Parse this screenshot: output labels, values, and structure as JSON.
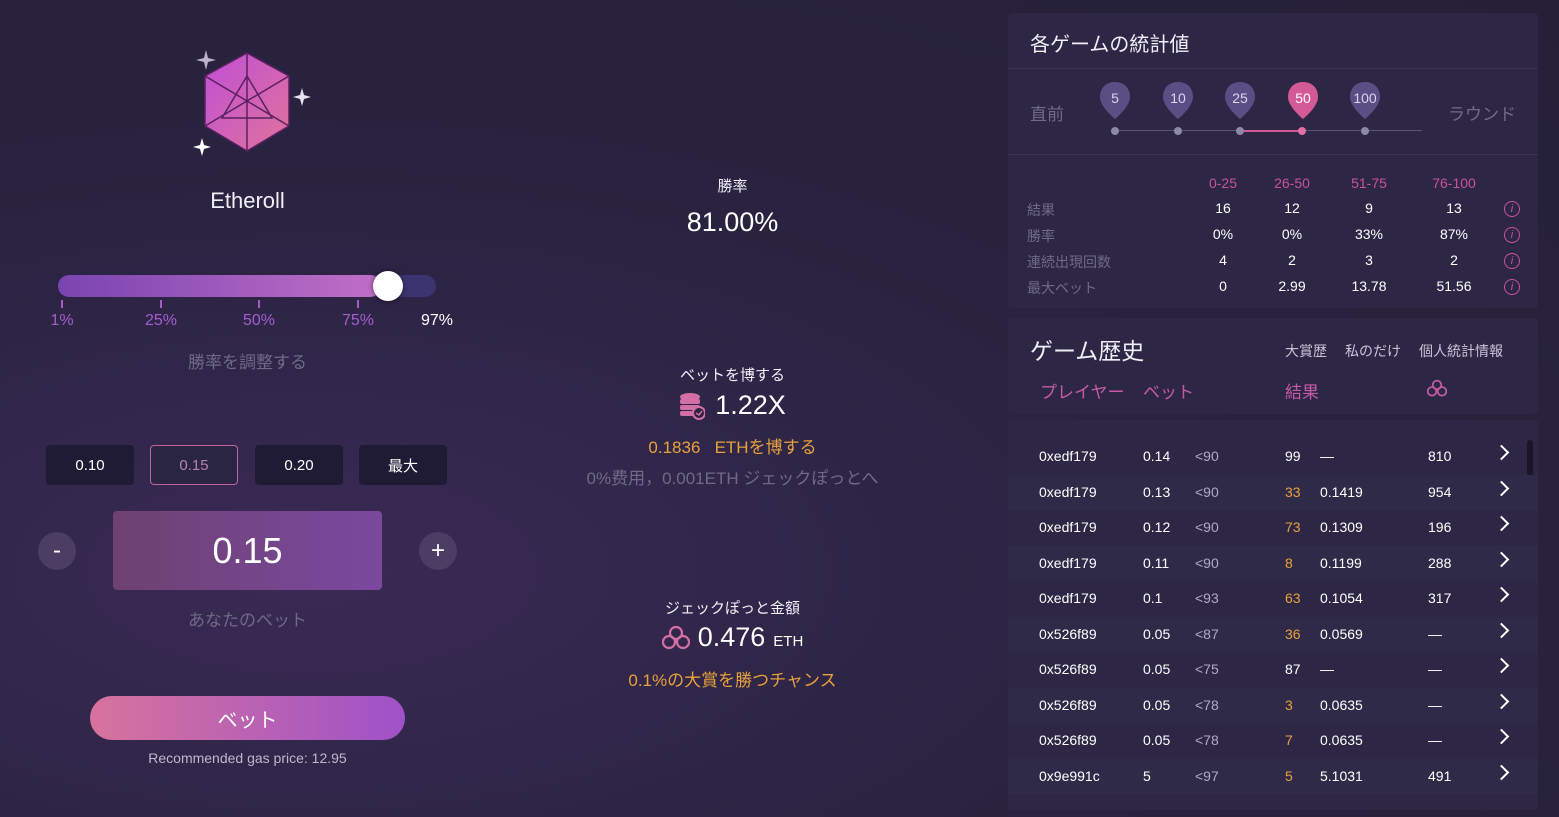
{
  "game": {
    "name": "Etheroll"
  },
  "slider": {
    "value_percent": 97,
    "ticks": [
      "1%",
      "25%",
      "50%",
      "75%"
    ],
    "current_label": "97%",
    "hint": "勝率を調整する"
  },
  "bet": {
    "chips": [
      "0.10",
      "0.15",
      "0.20",
      "最大"
    ],
    "active_chip": "0.15",
    "minus": "-",
    "plus": "+",
    "value": "0.15",
    "hint": "あなたのベット",
    "button": "ベット",
    "gas": "Recommended gas price: 12.95"
  },
  "middle": {
    "winrate_label": "勝率",
    "winrate_value": "81.00%",
    "payout_label": "ベットを博する",
    "payout_value": "1.22X",
    "payout_amount": "0.1836",
    "payout_amount_suffix": "ETHを博する",
    "fee_text": "0%费用，0.001ETH ジェックぽっとへ",
    "jackpot_label": "ジェックぽっと金額",
    "jackpot_value": "0.476",
    "jackpot_unit": "ETH",
    "jackpot_chance": "0.1%の大賞を勝つチャンス"
  },
  "stats": {
    "title": "各ゲームの統計値",
    "left_label": "直前",
    "right_label": "ラウンド",
    "rounds": [
      "5",
      "10",
      "25",
      "50",
      "100"
    ],
    "selected_round": "50",
    "columns": [
      "0-25",
      "26-50",
      "51-75",
      "76-100"
    ],
    "rows": [
      {
        "label": "結果",
        "values": [
          "16",
          "12",
          "9",
          "13"
        ]
      },
      {
        "label": "勝率",
        "values": [
          "0%",
          "0%",
          "33%",
          "87%"
        ]
      },
      {
        "label": "連続出現回数",
        "values": [
          "4",
          "2",
          "3",
          "2"
        ]
      },
      {
        "label": "最大ベット",
        "values": [
          "0",
          "2.99",
          "13.78",
          "51.56"
        ]
      }
    ],
    "info_glyph": "i"
  },
  "history": {
    "title": "ゲーム歴史",
    "tabs": [
      "大賞歴",
      "私のだけ",
      "個人統計情報"
    ],
    "headers": {
      "player": "プレイヤー",
      "bet": "ベット",
      "result": "結果"
    },
    "rows": [
      {
        "player": "0xedf179",
        "bet": "0.14",
        "target": "<90",
        "roll": "99",
        "win": false,
        "payout": "—",
        "extra": "810"
      },
      {
        "player": "0xedf179",
        "bet": "0.13",
        "target": "<90",
        "roll": "33",
        "win": true,
        "payout": "0.1419",
        "extra": "954"
      },
      {
        "player": "0xedf179",
        "bet": "0.12",
        "target": "<90",
        "roll": "73",
        "win": true,
        "payout": "0.1309",
        "extra": "196"
      },
      {
        "player": "0xedf179",
        "bet": "0.11",
        "target": "<90",
        "roll": "8",
        "win": true,
        "payout": "0.1199",
        "extra": "288"
      },
      {
        "player": "0xedf179",
        "bet": "0.1",
        "target": "<93",
        "roll": "63",
        "win": true,
        "payout": "0.1054",
        "extra": "317"
      },
      {
        "player": "0x526f89",
        "bet": "0.05",
        "target": "<87",
        "roll": "36",
        "win": true,
        "payout": "0.0569",
        "extra": "—"
      },
      {
        "player": "0x526f89",
        "bet": "0.05",
        "target": "<75",
        "roll": "87",
        "win": false,
        "payout": "—",
        "extra": "—"
      },
      {
        "player": "0x526f89",
        "bet": "0.05",
        "target": "<78",
        "roll": "3",
        "win": true,
        "payout": "0.0635",
        "extra": "—"
      },
      {
        "player": "0x526f89",
        "bet": "0.05",
        "target": "<78",
        "roll": "7",
        "win": true,
        "payout": "0.0635",
        "extra": "—"
      },
      {
        "player": "0x9e991c",
        "bet": "5",
        "target": "<97",
        "roll": "5",
        "win": true,
        "payout": "5.1031",
        "extra": "491"
      }
    ]
  },
  "colors": {
    "accent": "#c9529b",
    "win": "#e8a23a",
    "panel": "#2d2745"
  }
}
